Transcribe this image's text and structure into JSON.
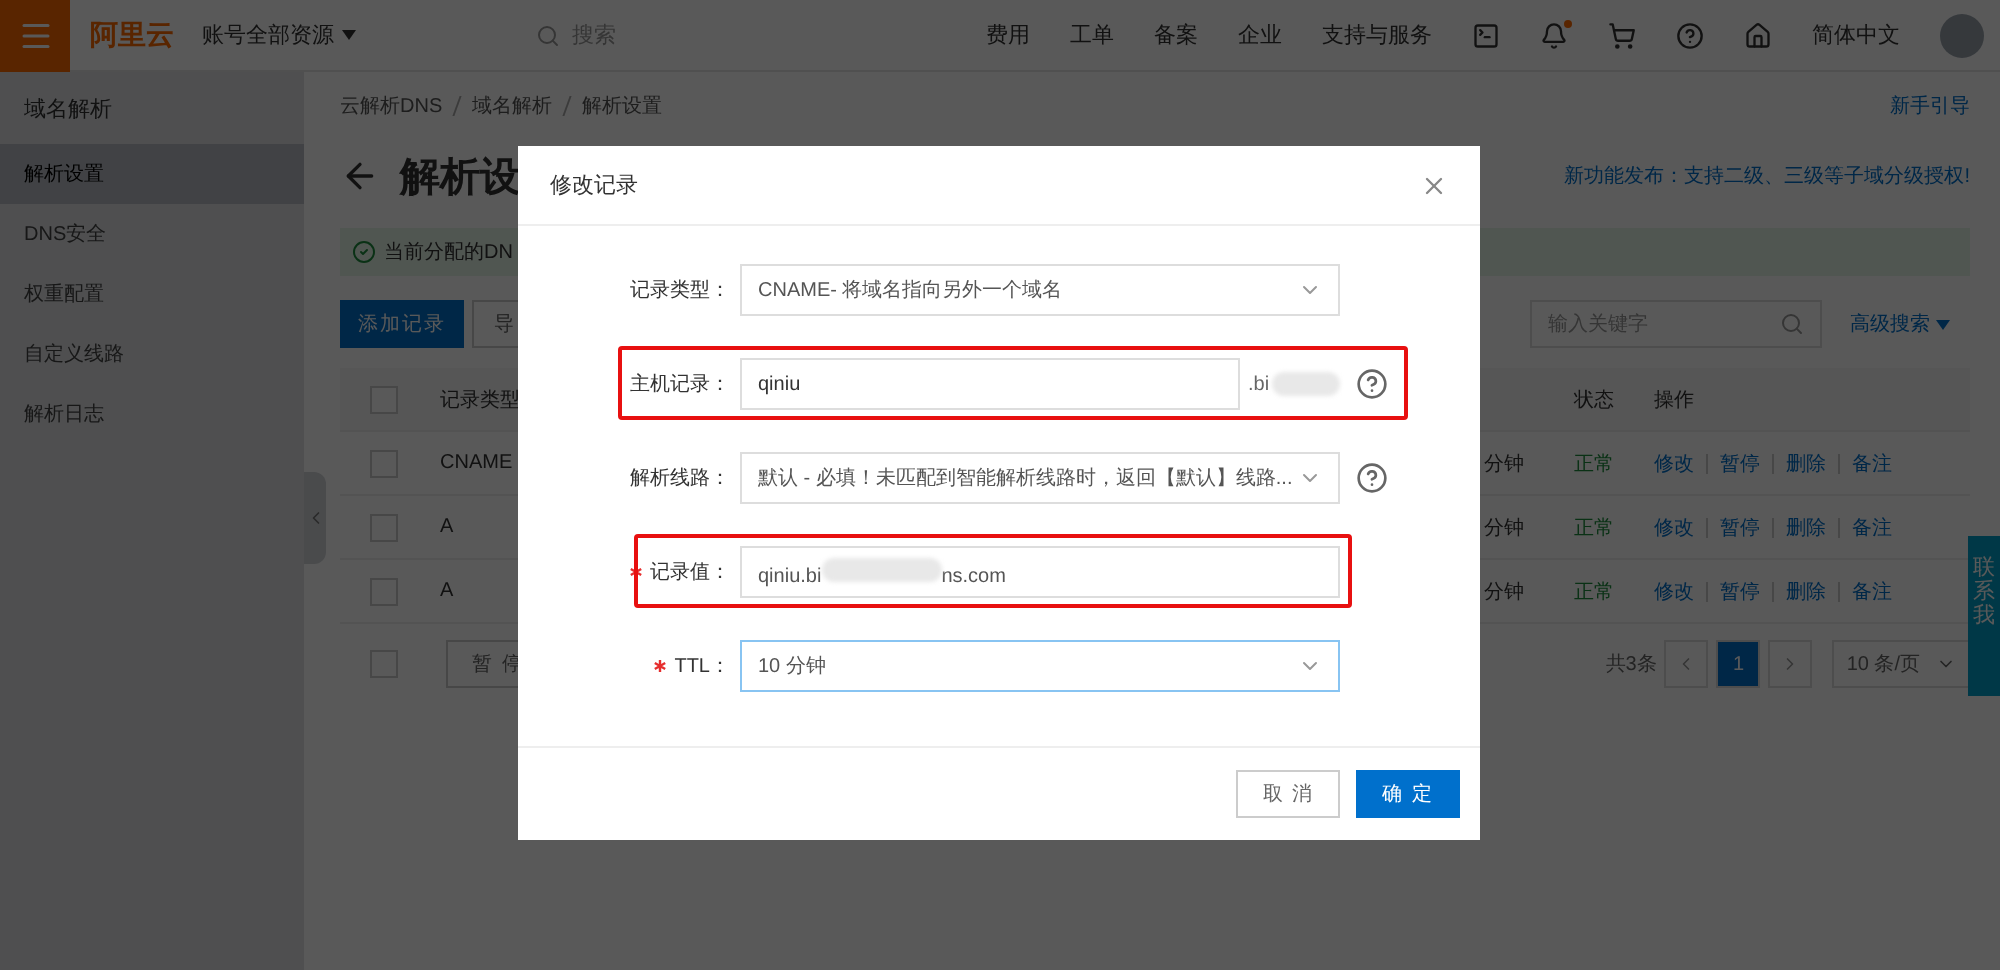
{
  "topbar": {
    "logo": "阿里云",
    "account_menu": "账号全部资源",
    "search": {
      "placeholder": "搜索"
    },
    "nav": [
      "费用",
      "工单",
      "备案",
      "企业",
      "支持与服务"
    ],
    "notification_dot": true,
    "language": "简体中文"
  },
  "sidebar": {
    "title": "域名解析",
    "items": [
      {
        "label": "解析设置",
        "selected": true
      },
      {
        "label": "DNS安全",
        "selected": false
      },
      {
        "label": "权重配置",
        "selected": false
      },
      {
        "label": "自定义线路",
        "selected": false
      },
      {
        "label": "解析日志",
        "selected": false
      }
    ]
  },
  "breadcrumb": [
    "云解析DNS",
    "域名解析",
    "解析设置"
  ],
  "guide_link": "新手引导",
  "page_title": "解析设",
  "announcement": "新功能发布：支持二级、三级等子域分级授权!",
  "alert": "当前分配的DN",
  "toolbar": {
    "add_button": "添加记录",
    "import_button": "导",
    "search": {
      "placeholder": "输入关键字"
    },
    "advanced_search": "高级搜索"
  },
  "table": {
    "header_checked": false,
    "columns": [
      "记录类型",
      "状态",
      "操作"
    ],
    "rows": [
      {
        "checked": false,
        "type": "CNAME",
        "ttl": "分钟",
        "status": "正常",
        "actions": [
          "修改",
          "暂停",
          "删除",
          "备注"
        ]
      },
      {
        "checked": false,
        "type": "A",
        "ttl": "分钟",
        "status": "正常",
        "actions": [
          "修改",
          "暂停",
          "删除",
          "备注"
        ]
      },
      {
        "checked": false,
        "type": "A",
        "ttl": "分钟",
        "status": "正常",
        "actions": [
          "修改",
          "暂停",
          "删除",
          "备注"
        ]
      }
    ],
    "footer": {
      "checked": false,
      "pause_button": "暂 停",
      "total": "共3条",
      "pages": [
        {
          "label": "1",
          "selected": true
        }
      ],
      "page_size": "10 条/页"
    }
  },
  "contact_tab": "联系我",
  "dialog": {
    "title": "修改记录",
    "fields": [
      {
        "kind": "select",
        "label": "记录类型：",
        "required": false,
        "value": "CNAME- 将域名指向另外一个域名",
        "help": false,
        "highlighted": false,
        "focused": false
      },
      {
        "kind": "input",
        "label": "主机记录：",
        "required": false,
        "value": "qiniu",
        "suffix": ".bi",
        "help": true,
        "highlighted": true,
        "focused": false
      },
      {
        "kind": "select",
        "label": "解析线路：",
        "required": false,
        "value": "默认 - 必填！未匹配到智能解析线路时，返回【默认】线路...",
        "help": true,
        "highlighted": false,
        "focused": false
      },
      {
        "kind": "masked",
        "label": "记录值：",
        "required": true,
        "value": "qiniu.bi",
        "value_tail": "ns.com",
        "help": false,
        "highlighted": true,
        "focused": false
      },
      {
        "kind": "select",
        "label": "TTL：",
        "required": true,
        "value": "10 分钟",
        "help": false,
        "highlighted": false,
        "focused": true
      }
    ],
    "buttons": [
      {
        "label": "取 消",
        "primary": false
      },
      {
        "label": "确 定",
        "primary": true
      }
    ]
  }
}
